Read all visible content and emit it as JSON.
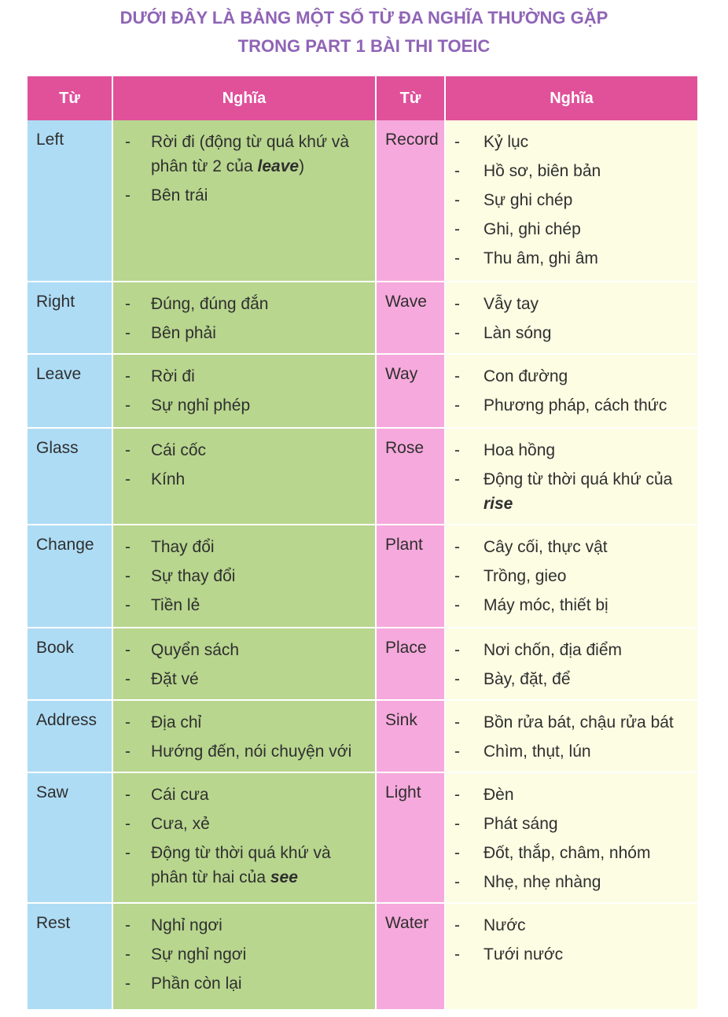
{
  "title": {
    "line1": "DƯỚI ĐÂY LÀ BẢNG MỘT SỐ TỪ ĐA NGHĨA THƯỜNG GẶP",
    "line2": "TRONG PART 1 BÀI THI TOEIC"
  },
  "headers": [
    "Từ",
    "Nghĩa",
    "Từ",
    "Nghĩa"
  ],
  "rows": [
    {
      "w1": "Left",
      "m1": [
        {
          "text": "Rời đi (động từ quá khứ và phân từ 2 của ",
          "em": "leave",
          "after": ")"
        },
        {
          "text": "Bên trái",
          "em": "",
          "after": ""
        }
      ],
      "w2": "Record",
      "m2": [
        {
          "text": "Kỷ lục",
          "em": "",
          "after": ""
        },
        {
          "text": "Hồ sơ, biên bản",
          "em": "",
          "after": ""
        },
        {
          "text": "Sự ghi chép",
          "em": "",
          "after": ""
        },
        {
          "text": "Ghi, ghi chép",
          "em": "",
          "after": ""
        },
        {
          "text": "Thu âm, ghi âm",
          "em": "",
          "after": ""
        }
      ]
    },
    {
      "w1": "Right",
      "m1": [
        {
          "text": "Đúng, đúng đắn",
          "em": "",
          "after": ""
        },
        {
          "text": "Bên phải",
          "em": "",
          "after": ""
        }
      ],
      "w2": "Wave",
      "m2": [
        {
          "text": "Vẫy tay",
          "em": "",
          "after": ""
        },
        {
          "text": "Làn sóng",
          "em": "",
          "after": ""
        }
      ]
    },
    {
      "w1": "Leave",
      "m1": [
        {
          "text": "Rời đi",
          "em": "",
          "after": ""
        },
        {
          "text": "Sự nghỉ phép",
          "em": "",
          "after": ""
        }
      ],
      "w2": "Way",
      "m2": [
        {
          "text": "Con đường",
          "em": "",
          "after": ""
        },
        {
          "text": "Phương pháp, cách thức",
          "em": "",
          "after": ""
        }
      ]
    },
    {
      "w1": "Glass",
      "m1": [
        {
          "text": "Cái cốc",
          "em": "",
          "after": ""
        },
        {
          "text": "Kính",
          "em": "",
          "after": ""
        }
      ],
      "w2": "Rose",
      "m2": [
        {
          "text": "Hoa hồng",
          "em": "",
          "after": ""
        },
        {
          "text": "Động từ thời quá khứ của ",
          "em": "rise",
          "after": ""
        }
      ]
    },
    {
      "w1": "Change",
      "m1": [
        {
          "text": "Thay đổi",
          "em": "",
          "after": ""
        },
        {
          "text": "Sự thay đổi",
          "em": "",
          "after": ""
        },
        {
          "text": "Tiền lẻ",
          "em": "",
          "after": ""
        }
      ],
      "w2": "Plant",
      "m2": [
        {
          "text": "Cây cối, thực vật",
          "em": "",
          "after": ""
        },
        {
          "text": "Trồng, gieo",
          "em": "",
          "after": ""
        },
        {
          "text": "Máy móc, thiết bị",
          "em": "",
          "after": ""
        }
      ]
    },
    {
      "w1": "Book",
      "m1": [
        {
          "text": "Quyển sách",
          "em": "",
          "after": ""
        },
        {
          "text": "Đặt vé",
          "em": "",
          "after": ""
        }
      ],
      "w2": "Place",
      "m2": [
        {
          "text": "Nơi chốn, địa điểm",
          "em": "",
          "after": ""
        },
        {
          "text": "Bày, đặt, để",
          "em": "",
          "after": ""
        }
      ]
    },
    {
      "w1": "Address",
      "m1": [
        {
          "text": "Địa chỉ",
          "em": "",
          "after": ""
        },
        {
          "text": "Hướng đến, nói chuyện với",
          "em": "",
          "after": ""
        }
      ],
      "w2": "Sink",
      "m2": [
        {
          "text": "Bồn rửa bát, chậu rửa bát",
          "em": "",
          "after": ""
        },
        {
          "text": "Chìm, thụt, lún",
          "em": "",
          "after": ""
        }
      ]
    },
    {
      "w1": "Saw",
      "m1": [
        {
          "text": "Cái cưa",
          "em": "",
          "after": ""
        },
        {
          "text": "Cưa, xẻ",
          "em": "",
          "after": ""
        },
        {
          "text": "Động từ thời quá khứ và phân từ hai của ",
          "em": "see",
          "after": ""
        }
      ],
      "w2": "Light",
      "m2": [
        {
          "text": "Đèn",
          "em": "",
          "after": ""
        },
        {
          "text": "Phát sáng",
          "em": "",
          "after": ""
        },
        {
          "text": "Đốt, thắp, châm, nhóm",
          "em": "",
          "after": ""
        },
        {
          "text": "Nhẹ, nhẹ nhàng",
          "em": "",
          "after": ""
        }
      ]
    },
    {
      "w1": "Rest",
      "m1": [
        {
          "text": "Nghỉ ngơi",
          "em": "",
          "after": ""
        },
        {
          "text": "Sự nghỉ ngơi",
          "em": "",
          "after": ""
        },
        {
          "text": "Phần còn lại",
          "em": "",
          "after": ""
        }
      ],
      "w2": "Water",
      "m2": [
        {
          "text": "Nước",
          "em": "",
          "after": ""
        },
        {
          "text": "Tưới nước",
          "em": "",
          "after": ""
        }
      ]
    }
  ]
}
